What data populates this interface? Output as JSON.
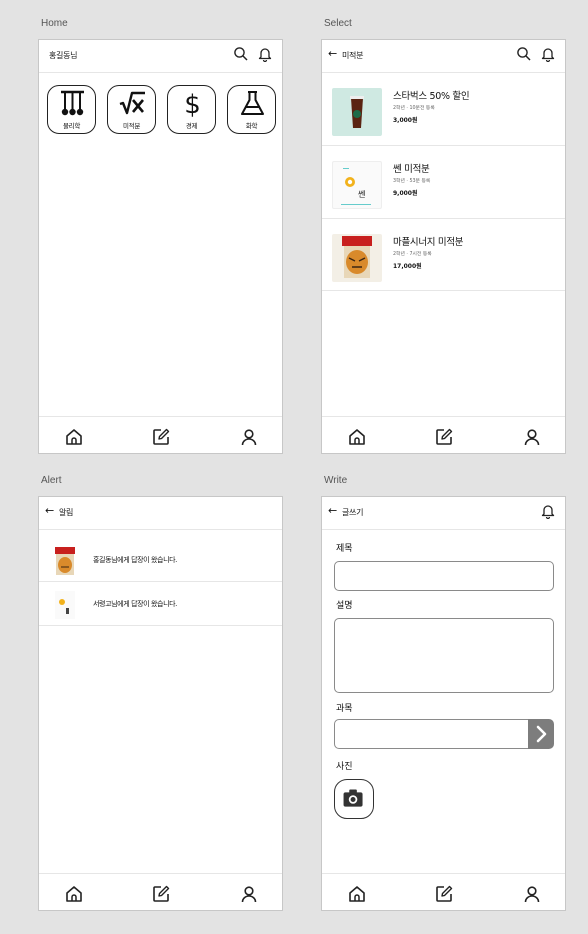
{
  "labels": {
    "home": "Home",
    "select": "Select",
    "alert": "Alert",
    "write": "Write"
  },
  "home": {
    "title": "홍길동님",
    "categories": [
      {
        "label": "물리학",
        "icon": "physics-icon"
      },
      {
        "label": "미적분",
        "icon": "sqrt-icon"
      },
      {
        "label": "경제",
        "icon": "dollar-icon"
      },
      {
        "label": "화학",
        "icon": "flask-icon"
      }
    ]
  },
  "select": {
    "title": "미적분",
    "items": [
      {
        "name": "스타벅스 50% 할인",
        "meta": "2학년 · 10문전 등록",
        "price": "3,000원",
        "thumb": "coffee-thumbnail"
      },
      {
        "name": "쎈 미적분",
        "meta": "3학년 · 53분 등록",
        "price": "9,000원",
        "thumb": "book-thumbnail"
      },
      {
        "name": "마플시너지 미적분",
        "meta": "2학년 · 7시전 등록",
        "price": "17,000원",
        "thumb": "tiger-book-thumbnail"
      }
    ]
  },
  "alert": {
    "title": "알림",
    "items": [
      {
        "text": "홍길동님에게 답장이 왔습니다.",
        "thumb": "tiger-book-thumbnail"
      },
      {
        "text": "서령고님에게 답장이 왔습니다.",
        "thumb": "book-thumbnail"
      }
    ]
  },
  "write": {
    "title": "글쓰기",
    "fields": {
      "title": "제목",
      "description": "설명",
      "subject": "과목",
      "photo": "사진"
    }
  },
  "nav": [
    "home-icon",
    "write-icon",
    "profile-icon"
  ],
  "colors": {
    "background": "#e3e3e3",
    "border": "#c7c7c7",
    "accent_gray": "#7d7d7d"
  }
}
